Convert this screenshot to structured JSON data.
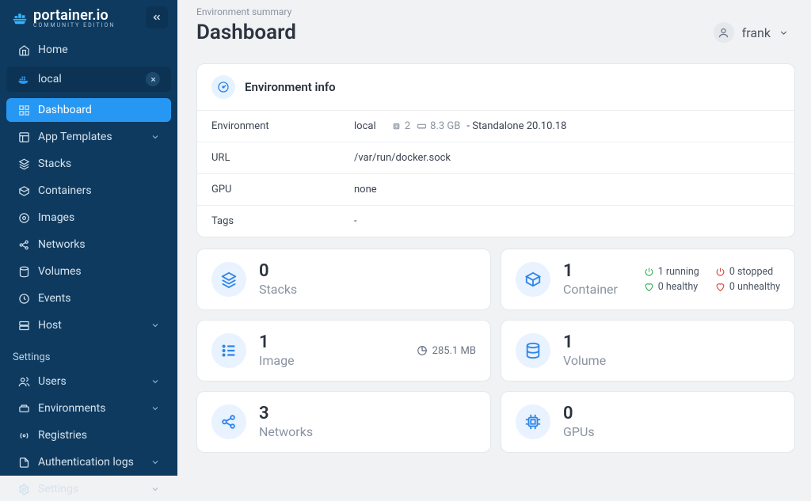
{
  "brand": {
    "name": "portainer.io",
    "sub": "COMMUNITY EDITION"
  },
  "sidebar": {
    "home": "Home",
    "env_name": "local",
    "items": [
      {
        "label": "Dashboard",
        "active": true
      },
      {
        "label": "App Templates",
        "expandable": true
      },
      {
        "label": "Stacks"
      },
      {
        "label": "Containers"
      },
      {
        "label": "Images"
      },
      {
        "label": "Networks"
      },
      {
        "label": "Volumes"
      },
      {
        "label": "Events"
      },
      {
        "label": "Host",
        "expandable": true
      }
    ],
    "settings_label": "Settings",
    "settings": [
      {
        "label": "Users",
        "expandable": true
      },
      {
        "label": "Environments",
        "expandable": true
      },
      {
        "label": "Registries"
      },
      {
        "label": "Authentication logs",
        "expandable": true
      },
      {
        "label": "Settings",
        "expandable": true
      }
    ]
  },
  "breadcrumb": "Environment summary",
  "page_title": "Dashboard",
  "user": {
    "name": "frank"
  },
  "env_info": {
    "title": "Environment info",
    "rows": {
      "env_label": "Environment",
      "env_value": "local",
      "cpu": "2",
      "mem": "8.3 GB",
      "mode": "- Standalone 20.10.18",
      "url_label": "URL",
      "url_value": "/var/run/docker.sock",
      "gpu_label": "GPU",
      "gpu_value": "none",
      "tags_label": "Tags",
      "tags_value": "-"
    }
  },
  "tiles": {
    "stacks": {
      "count": "0",
      "label": "Stacks"
    },
    "containers": {
      "count": "1",
      "label": "Container",
      "status": {
        "running": "1 running",
        "stopped": "0 stopped",
        "healthy": "0 healthy",
        "unhealthy": "0 unhealthy"
      }
    },
    "images": {
      "count": "1",
      "label": "Image",
      "size": "285.1 MB"
    },
    "volumes": {
      "count": "1",
      "label": "Volume"
    },
    "networks": {
      "count": "3",
      "label": "Networks"
    },
    "gpus": {
      "count": "0",
      "label": "GPUs"
    }
  }
}
